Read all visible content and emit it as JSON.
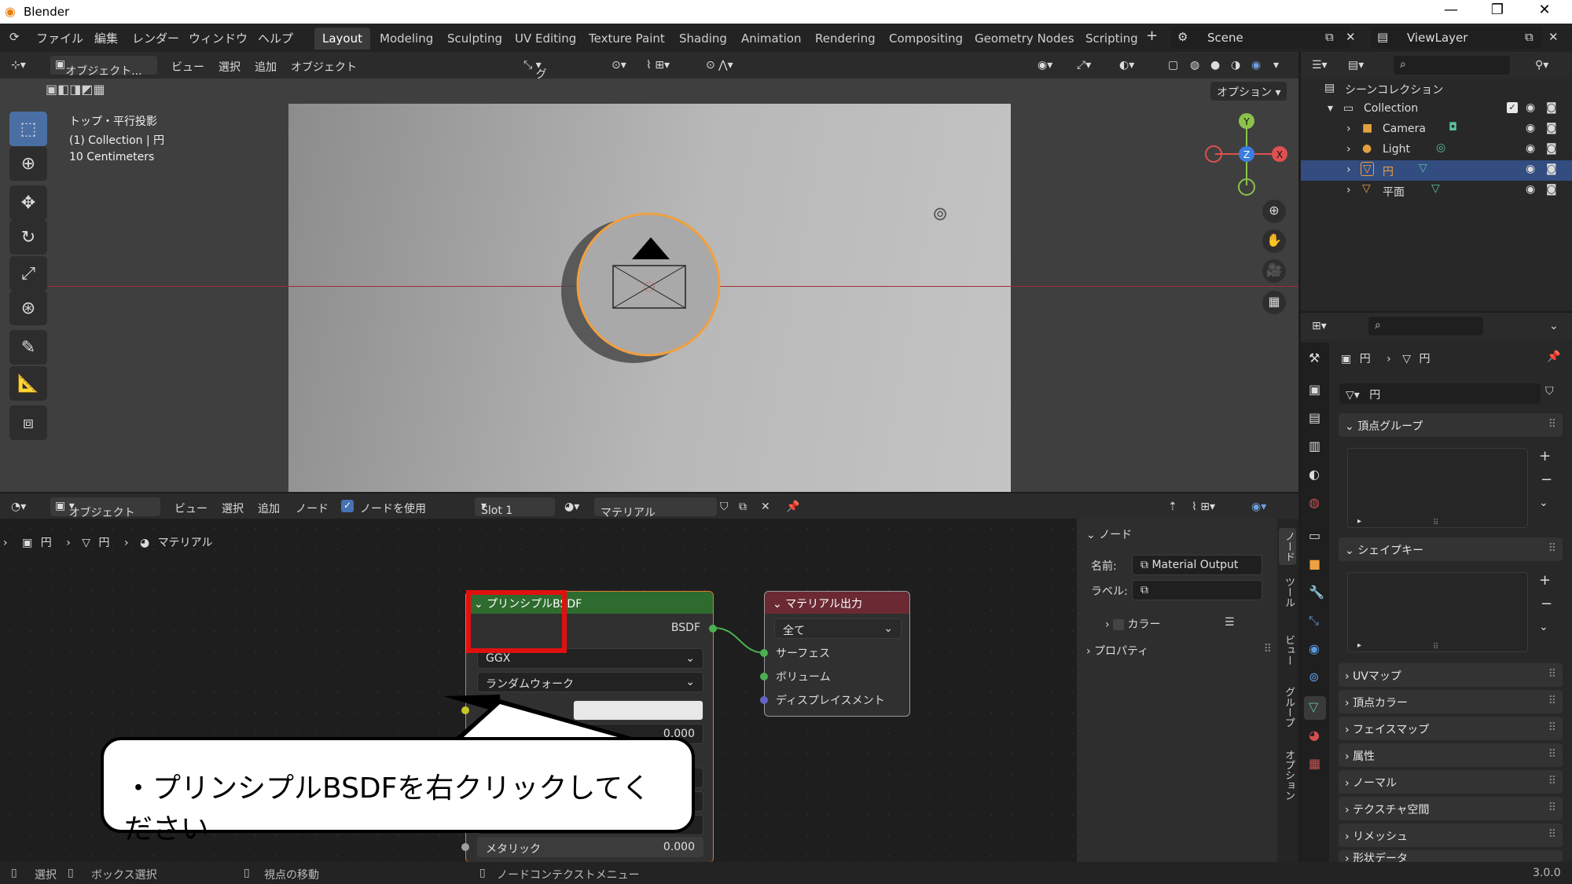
{
  "window": {
    "title": "Blender",
    "minimize": "—",
    "restore": "❐",
    "close": "✕"
  },
  "menu": [
    "ファイル",
    "編集",
    "レンダー",
    "ウィンドウ",
    "ヘルプ"
  ],
  "workspaces": [
    "Layout",
    "Modeling",
    "Sculpting",
    "UV Editing",
    "Texture Paint",
    "Shading",
    "Animation",
    "Rendering",
    "Compositing",
    "Geometry Nodes",
    "Scripting"
  ],
  "active_workspace": "Layout",
  "scene": "Scene",
  "view_layer": "ViewLayer",
  "viewport": {
    "header": {
      "mode": "オブジェクト...",
      "view": "ビュー",
      "select": "選択",
      "add": "追加",
      "object": "オブジェクト",
      "transform": "グロー...",
      "options": "オプション"
    },
    "overlay": {
      "line1": "トップ・平行投影",
      "line2": "(1) Collection | 円",
      "line3": "10 Centimeters"
    },
    "gizmo": {
      "y": "Y",
      "z": "Z",
      "x": "X"
    }
  },
  "node_editor": {
    "header": {
      "mode": "オブジェクト",
      "view": "ビュー",
      "select": "選択",
      "add": "追加",
      "node": "ノード",
      "use_nodes": "ノードを使用",
      "slot": "Slot 1",
      "material": "マテリアル"
    },
    "breadcrumb": [
      "円",
      "円",
      "マテリアル"
    ],
    "bsdf_node": {
      "title": "プリンシプルBSDF",
      "output": "BSDF",
      "distribution": "GGX",
      "subsurface": "ランダムウォーク",
      "value1": "0.000",
      "metallic_label": "メタリック",
      "metallic_value": "0.000"
    },
    "output_node": {
      "title": "マテリアル出力",
      "target": "全て",
      "inputs": [
        "サーフェス",
        "ボリューム",
        "ディスプレイスメント"
      ]
    }
  },
  "n_panel": {
    "section": "ノード",
    "name_label": "名前:",
    "name_value": "Material Output",
    "label_label": "ラベル:",
    "color": "カラー",
    "properties": "プロパティ"
  },
  "n_panel_tabs": [
    "ノード",
    "ツール",
    "ビュー",
    "グループ",
    "オプション"
  ],
  "outliner": {
    "scene_collection": "シーンコレクション",
    "items": [
      {
        "name": "Collection"
      },
      {
        "name": "Camera"
      },
      {
        "name": "Light"
      },
      {
        "name": "円"
      },
      {
        "name": "平面"
      }
    ]
  },
  "properties": {
    "breadcrumb": [
      "円",
      "円"
    ],
    "mesh_name": "円",
    "sections": [
      "頂点グループ",
      "シェイプキー",
      "UVマップ",
      "頂点カラー",
      "フェイスマップ",
      "属性",
      "ノーマル",
      "テクスチャ空間",
      "リメッシュ",
      "形状データ"
    ]
  },
  "callout": {
    "text": "・プリンシプルBSDFを右クリックしてください"
  },
  "statusbar": {
    "select": "選択",
    "box_select": "ボックス選択",
    "move_view": "視点の移動",
    "context_menu": "ノードコンテクストメニュー",
    "version": "3.0.0"
  },
  "colors": {
    "accent": "#4772b3",
    "highlight_box": "#e01010",
    "bsdf_header": "#2e6b2e",
    "output_header": "#6b2a33",
    "selection_outline": "#f0a040"
  }
}
